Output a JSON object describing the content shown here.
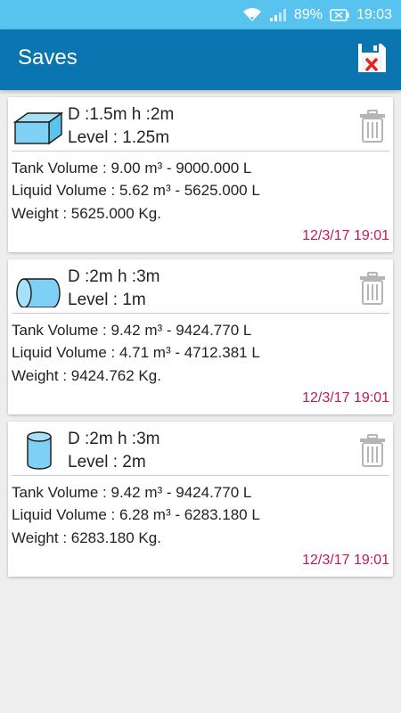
{
  "status_bar": {
    "battery": "89%",
    "time": "19:03"
  },
  "app_bar": {
    "title": "Saves",
    "action_icon": "save-clear-icon"
  },
  "saves": [
    {
      "shape_icon": "rectangular-tank-icon",
      "dims": "D :1.5m h :2m",
      "level": "Level : 1.25m",
      "tank_volume": "Tank Volume : 9.00 m³ - 9000.000 L",
      "liquid_volume": "Liquid Volume : 5.62 m³ - 5625.000 L",
      "weight": "Weight : 5625.000 Kg.",
      "date": "12/3/17 19:01"
    },
    {
      "shape_icon": "horizontal-cylinder-tank-icon",
      "dims": "D :2m h :3m",
      "level": "Level : 1m",
      "tank_volume": "Tank Volume : 9.42 m³ - 9424.770 L",
      "liquid_volume": "Liquid Volume : 4.71 m³ - 4712.381 L",
      "weight": "Weight : 9424.762 Kg.",
      "date": "12/3/17 19:01"
    },
    {
      "shape_icon": "vertical-cylinder-tank-icon",
      "dims": "D :2m h :3m",
      "level": "Level : 2m",
      "tank_volume": "Tank Volume : 9.42 m³ - 9424.770 L",
      "liquid_volume": "Liquid Volume : 6.28 m³ - 6283.180 L",
      "weight": "Weight : 6283.180 Kg.",
      "date": "12/3/17 19:01"
    }
  ],
  "colors": {
    "status_bar": "#58c3ee",
    "app_bar": "#0a75b0",
    "date_text": "#c2185b",
    "divider": "#f2b8cf",
    "tank_fill": "#7fd0f5"
  }
}
